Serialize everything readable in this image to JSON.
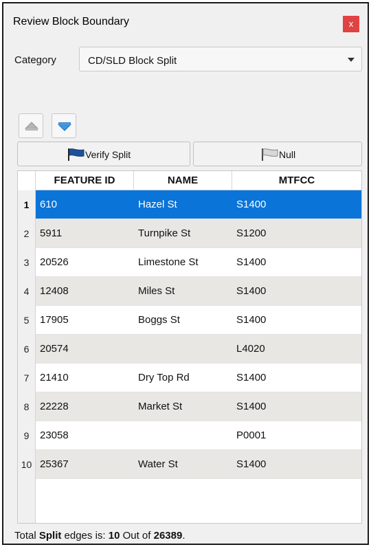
{
  "window": {
    "title": "Review Block Boundary",
    "close_glyph": "x"
  },
  "category": {
    "label": "Category",
    "selected": "CD/SLD Block Split"
  },
  "nav": {
    "up_icon": "triangle-up-icon",
    "down_icon": "triangle-down-icon"
  },
  "actions": {
    "verify_label": "Verify Split",
    "null_label": "Null",
    "verify_icon_color": "#1f4f99",
    "null_icon_color": "#b0b0b0"
  },
  "table": {
    "headers": [
      "FEATURE ID",
      "NAME",
      "MTFCC"
    ],
    "selected_row": 1,
    "selection_color": "#0a74d8",
    "rows": [
      {
        "num": "1",
        "feature_id": "610",
        "name": "Hazel St",
        "mtfcc": "S1400"
      },
      {
        "num": "2",
        "feature_id": "5911",
        "name": "Turnpike St",
        "mtfcc": "S1200"
      },
      {
        "num": "3",
        "feature_id": "20526",
        "name": "Limestone St",
        "mtfcc": "S1400"
      },
      {
        "num": "4",
        "feature_id": "12408",
        "name": "Miles St",
        "mtfcc": "S1400"
      },
      {
        "num": "5",
        "feature_id": "17905",
        "name": "Boggs St",
        "mtfcc": "S1400"
      },
      {
        "num": "6",
        "feature_id": "20574",
        "name": "",
        "mtfcc": "L4020"
      },
      {
        "num": "7",
        "feature_id": "21410",
        "name": "Dry Top Rd",
        "mtfcc": "S1400"
      },
      {
        "num": "8",
        "feature_id": "22228",
        "name": "Market St",
        "mtfcc": "S1400"
      },
      {
        "num": "9",
        "feature_id": "23058",
        "name": "",
        "mtfcc": "P0001"
      },
      {
        "num": "10",
        "feature_id": "25367",
        "name": "Water St",
        "mtfcc": "S1400"
      }
    ]
  },
  "status": {
    "prefix": "Total ",
    "bold_word": "Split",
    "middle": " edges is: ",
    "count": "10",
    "out_of": " Out of ",
    "total": "26389",
    "suffix": "."
  }
}
